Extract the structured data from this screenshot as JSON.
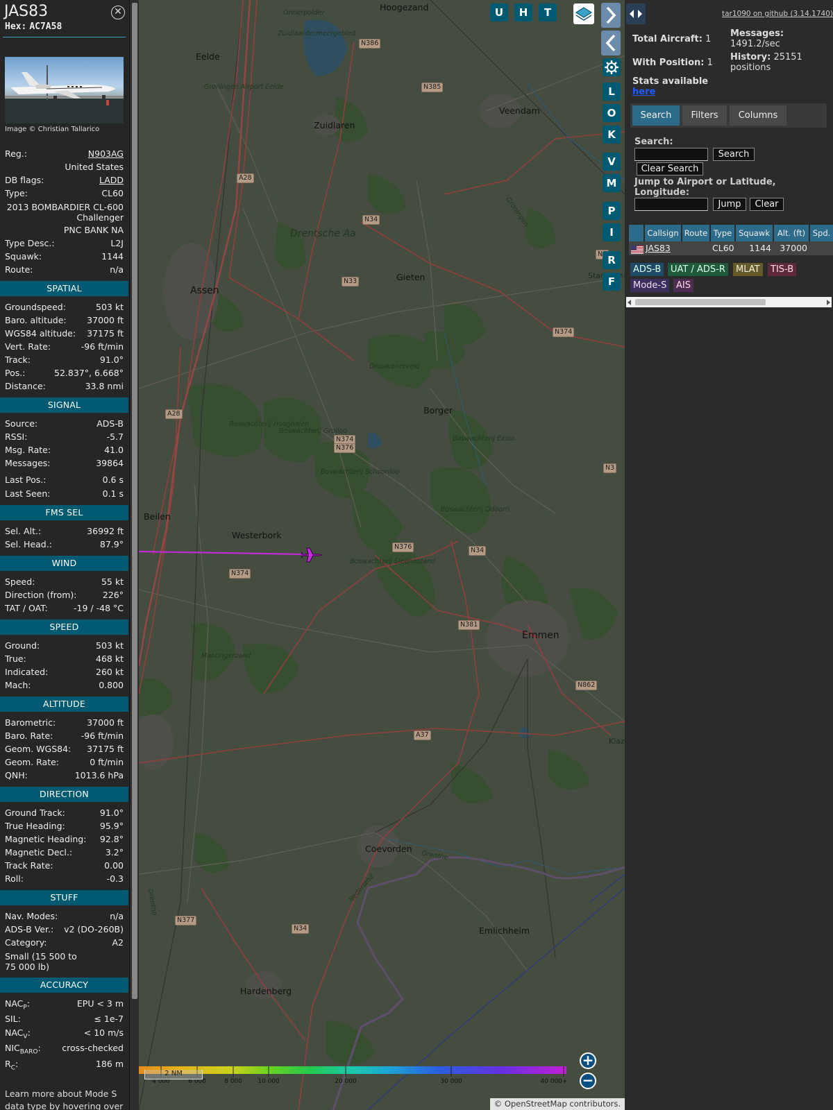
{
  "aircraft": {
    "callsign": "JAS83",
    "hex_label": "Hex:",
    "hex": "AC7A58",
    "photo_credit": "Image © Christian Tallarico"
  },
  "details": {
    "reg_label": "Reg.:",
    "reg": "N903AG",
    "country": "United States",
    "dbflags_label": "DB flags:",
    "dbflags": "LADD",
    "type_label": "Type:",
    "type": "CL60",
    "type_full": "2013 BOMBARDIER CL-600 Challenger",
    "owner": "PNC BANK NA",
    "typedesc_label": "Type Desc.:",
    "typedesc": "L2J",
    "squawk_label": "Squawk:",
    "squawk": "1144",
    "route_label": "Route:",
    "route": "n/a"
  },
  "spatial": {
    "title": "SPATIAL",
    "rows": [
      {
        "k": "Groundspeed:",
        "v": "503 kt"
      },
      {
        "k": "Baro. altitude:",
        "v": "37000 ft"
      },
      {
        "k": "WGS84 altitude:",
        "v": "37175 ft"
      },
      {
        "k": "Vert. Rate:",
        "v": "-96 ft/min"
      },
      {
        "k": "Track:",
        "v": "91.0°"
      },
      {
        "k": "Pos.:",
        "v": "52.837°, 6.668°"
      },
      {
        "k": "Distance:",
        "v": "33.8 nmi"
      }
    ]
  },
  "signal": {
    "title": "SIGNAL",
    "rows": [
      {
        "k": "Source:",
        "v": "ADS-B"
      },
      {
        "k": "RSSI:",
        "v": "-5.7"
      },
      {
        "k": "Msg. Rate:",
        "v": "41.0"
      },
      {
        "k": "Messages:",
        "v": "39864"
      },
      {
        "k": "Last Pos.:",
        "v": "0.6 s"
      },
      {
        "k": "Last Seen:",
        "v": "0.1 s"
      }
    ]
  },
  "fms": {
    "title": "FMS SEL",
    "rows": [
      {
        "k": "Sel. Alt.:",
        "v": "36992 ft"
      },
      {
        "k": "Sel. Head.:",
        "v": "87.9°"
      }
    ]
  },
  "wind": {
    "title": "WIND",
    "rows": [
      {
        "k": "Speed:",
        "v": "55 kt"
      },
      {
        "k": "Direction (from):",
        "v": "226°"
      },
      {
        "k": "TAT / OAT:",
        "v": "-19 / -48 °C"
      }
    ]
  },
  "speed": {
    "title": "SPEED",
    "rows": [
      {
        "k": "Ground:",
        "v": "503 kt"
      },
      {
        "k": "True:",
        "v": "468 kt"
      },
      {
        "k": "Indicated:",
        "v": "260 kt"
      },
      {
        "k": "Mach:",
        "v": "0.800"
      }
    ]
  },
  "altitude": {
    "title": "ALTITUDE",
    "rows": [
      {
        "k": "Barometric:",
        "v": "37000 ft"
      },
      {
        "k": "Baro. Rate:",
        "v": "-96 ft/min"
      },
      {
        "k": "Geom. WGS84:",
        "v": "37175 ft"
      },
      {
        "k": "Geom. Rate:",
        "v": "0 ft/min"
      },
      {
        "k": "QNH:",
        "v": "1013.6 hPa"
      }
    ]
  },
  "direction": {
    "title": "DIRECTION",
    "rows": [
      {
        "k": "Ground Track:",
        "v": "91.0°"
      },
      {
        "k": "True Heading:",
        "v": "95.9°"
      },
      {
        "k": "Magnetic Heading:",
        "v": "92.8°"
      },
      {
        "k": "Magnetic Decl.:",
        "v": "3.2°"
      },
      {
        "k": "Track Rate:",
        "v": "0.00"
      },
      {
        "k": "Roll:",
        "v": "-0.3"
      }
    ]
  },
  "stuff": {
    "title": "STUFF",
    "rows": [
      {
        "k": "Nav. Modes:",
        "v": "n/a"
      },
      {
        "k": "ADS-B Ver.:",
        "v": "v2 (DO-260B)"
      },
      {
        "k": "Category:",
        "v": "A2"
      }
    ],
    "category_desc": "Small (15 500 to 75 000 lb)"
  },
  "accuracy": {
    "title": "ACCURACY",
    "nacp_label": "NAC",
    "nacp_sub": "P",
    "nacp": "EPU < 3 m",
    "sil_label": "SIL:",
    "sil": "≤ 1e-7",
    "nacv_label": "NAC",
    "nacv_sub": "V",
    "nacv": "< 10 m/s",
    "nicbaro_label": "NIC",
    "nicbaro_sub": "BARO",
    "nicbaro": "cross-checked",
    "rc_label": "R",
    "rc_sub": "C",
    "rc": "186 m"
  },
  "learn_more": "Learn more about Mode S data type by hovering over",
  "map": {
    "buttons_top": [
      "U",
      "H",
      "T"
    ],
    "buttons_side": [
      "L",
      "O",
      "K",
      "V",
      "M",
      "P",
      "I",
      "R",
      "F"
    ],
    "zoom_in": "+",
    "zoom_out": "−",
    "scale": "2 NM",
    "attribution_prefix": "©",
    "attribution_link": "OpenStreetMap",
    "attribution_suffix": "contributors.",
    "legend_ticks": [
      "4 000",
      "6 000",
      "8 000",
      "10 000",
      "20 000",
      "30 000",
      "40 000+"
    ],
    "places": {
      "hoogezand": "Hoogezand",
      "onnerpolder": "Onnerpolder",
      "zuidlaardermeer": "Zuidlaardermeergebied",
      "eelde": "Eelde",
      "groningen_airport": "Groningen Airport Eelde",
      "zuidlaren": "Zuidlaren",
      "veendam": "Veendam",
      "drentsche_aa": "Drentsche Aa",
      "assen": "Assen",
      "gieten": "Gieten",
      "stadskanaal": "Stadskana",
      "drouwenerveld": "Drouwenerveld",
      "borger": "Borger",
      "bosw_hooghalen": "Boswachterij Hooghalen",
      "bosw_grolloo": "Boswachterij Grolloo",
      "bosw_exloo": "Boswachterij Exloo",
      "bosw_schoonloo": "Boswachterij Schoonloo",
      "bosw_odoorn": "Boswachterij Odoorn",
      "beilen": "Beilen",
      "westerbork": "Westerbork",
      "bosw_sleenerzand": "Boswachterij Sleenerzand",
      "emmen": "Emmen",
      "mantingerzand": "Mantingerzand",
      "klazienaveen": "Klaz",
      "coevorden": "Coevorden",
      "drenthe": "Drenthe",
      "drenthe2": "Drenthe",
      "nederland": "Nederland",
      "emlichheim": "Emlichheim",
      "hardenberg": "Hardenberg",
      "groningen_road": "Groningen"
    },
    "roads": {
      "n386": "N386",
      "n385": "N385",
      "a28a": "A28",
      "a28b": "A28",
      "n34a": "N34",
      "n33": "N33",
      "n374a": "N374",
      "n374b": "N374",
      "n376a": "N376",
      "n376b": "N376",
      "n374c": "N374",
      "n34b": "N34",
      "n381": "N381",
      "n862": "N862",
      "a37": "A37",
      "n377": "N377",
      "n34c": "N34",
      "n3x": "N3",
      "n3y": "N3"
    }
  },
  "right": {
    "github": "tar1090 on github (3.14.1740)",
    "total_aircraft_label": "Total Aircraft:",
    "total_aircraft": "1",
    "with_position_label": "With Position:",
    "with_position": "1",
    "messages_label": "Messages:",
    "messages": "1491.2/sec",
    "history_label": "History:",
    "history": "25151 positions",
    "stats_label": "Stats available",
    "stats_link": "here",
    "tabs": [
      "Search",
      "Filters",
      "Columns"
    ],
    "search_label": "Search:",
    "search_button": "Search",
    "clear_search_button": "Clear Search",
    "jump_label": "Jump to Airport or Latitude, Longitude:",
    "jump_button": "Jump",
    "clear_button": "Clear",
    "columns": [
      "Callsign",
      "Route",
      "Type",
      "Squawk",
      "Alt. (ft)",
      "Spd."
    ],
    "row": {
      "callsign": "JAS83",
      "route": "",
      "type": "CL60",
      "squawk": "1144",
      "alt": "37000"
    },
    "sources": [
      "ADS-B",
      "UAT / ADS-R",
      "MLAT",
      "TIS-B",
      "Mode-S",
      "AIS"
    ]
  }
}
